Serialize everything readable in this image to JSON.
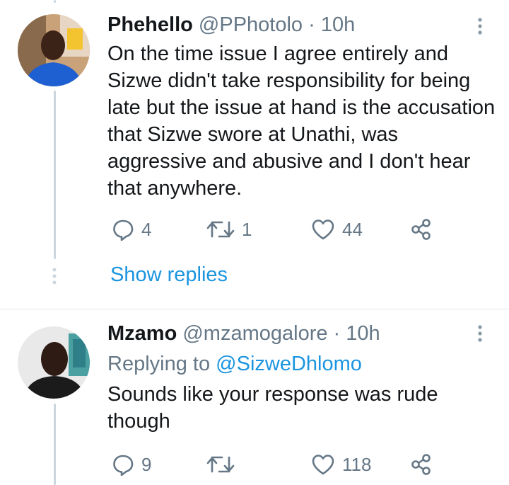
{
  "tweets": [
    {
      "name": "Phehello",
      "handle": "@PPhotolo",
      "separator": "·",
      "time": "10h",
      "text": "On the time issue I agree entirely and Sizwe didn't take responsibility for being late but the issue at hand is the accusation that Sizwe swore at Unathi, was aggressive and abusive and I don't hear that anywhere.",
      "replies": "4",
      "retweets": "1",
      "likes": "44"
    },
    {
      "name": "Mzamo",
      "handle": "@mzamogalore",
      "separator": "·",
      "time": "10h",
      "replying_prefix": "Replying to",
      "replying_to": "@SizweDhlomo",
      "text": "Sounds like your response was rude though",
      "replies": "9",
      "retweets": "",
      "likes": "118"
    }
  ],
  "show_replies_label": "Show replies",
  "colors": {
    "accent": "#1b95e0",
    "muted": "#657786",
    "thread_line": "#ccd6dd"
  },
  "icons": [
    "more-vertical-icon",
    "reply-icon",
    "retweet-icon",
    "like-icon",
    "share-icon"
  ]
}
